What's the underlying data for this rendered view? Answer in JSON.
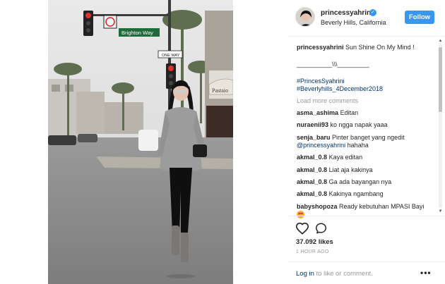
{
  "post": {
    "username": "princessyahrini",
    "location": "Beverly Hills, California",
    "follow_label": "Follow",
    "caption_user": "princessyahrini",
    "caption_text": "Sun Shine On My Mind !",
    "caption_divider": "__________\\\\\\_________",
    "hashtag_1": "#PrincesSyahrini",
    "hashtag_2": "#Beverlyhills_4December2018",
    "load_more": "Load more comments",
    "likes": "37.092 likes",
    "time_ago": "1 HOUR AGO",
    "login_link": "Log in",
    "login_rest": " to like or comment.",
    "more_dots": "•••"
  },
  "photo": {
    "signs": {
      "street": "Brighton Way",
      "one_way": "ONE WAY",
      "storefront": "Pastaio"
    }
  },
  "comments": [
    {
      "user": "asma_ashima",
      "text": "Editan"
    },
    {
      "user": "nuraenii93",
      "text": "ko ngga napak yaaa"
    },
    {
      "user": "senja_baru",
      "text": "Pinter banget yang ngedit",
      "mention": "@princessyahrini",
      "after": " hahaha"
    },
    {
      "user": "akmal_0.8",
      "text": "Kaya editan"
    },
    {
      "user": "akmal_0.8",
      "text": "Liat aja kakinya"
    },
    {
      "user": "akmal_0.8",
      "text": "Ga ada bayangan nya"
    },
    {
      "user": "akmal_0.8",
      "text": "Kakinya ngambang"
    },
    {
      "user": "babyshopoza",
      "text": "Ready kebutuhan MPASI Bayi",
      "emoji": "heart-eyes-emoji"
    }
  ],
  "colors": {
    "accent": "#3897f0",
    "link": "#003569",
    "muted": "#999999"
  }
}
